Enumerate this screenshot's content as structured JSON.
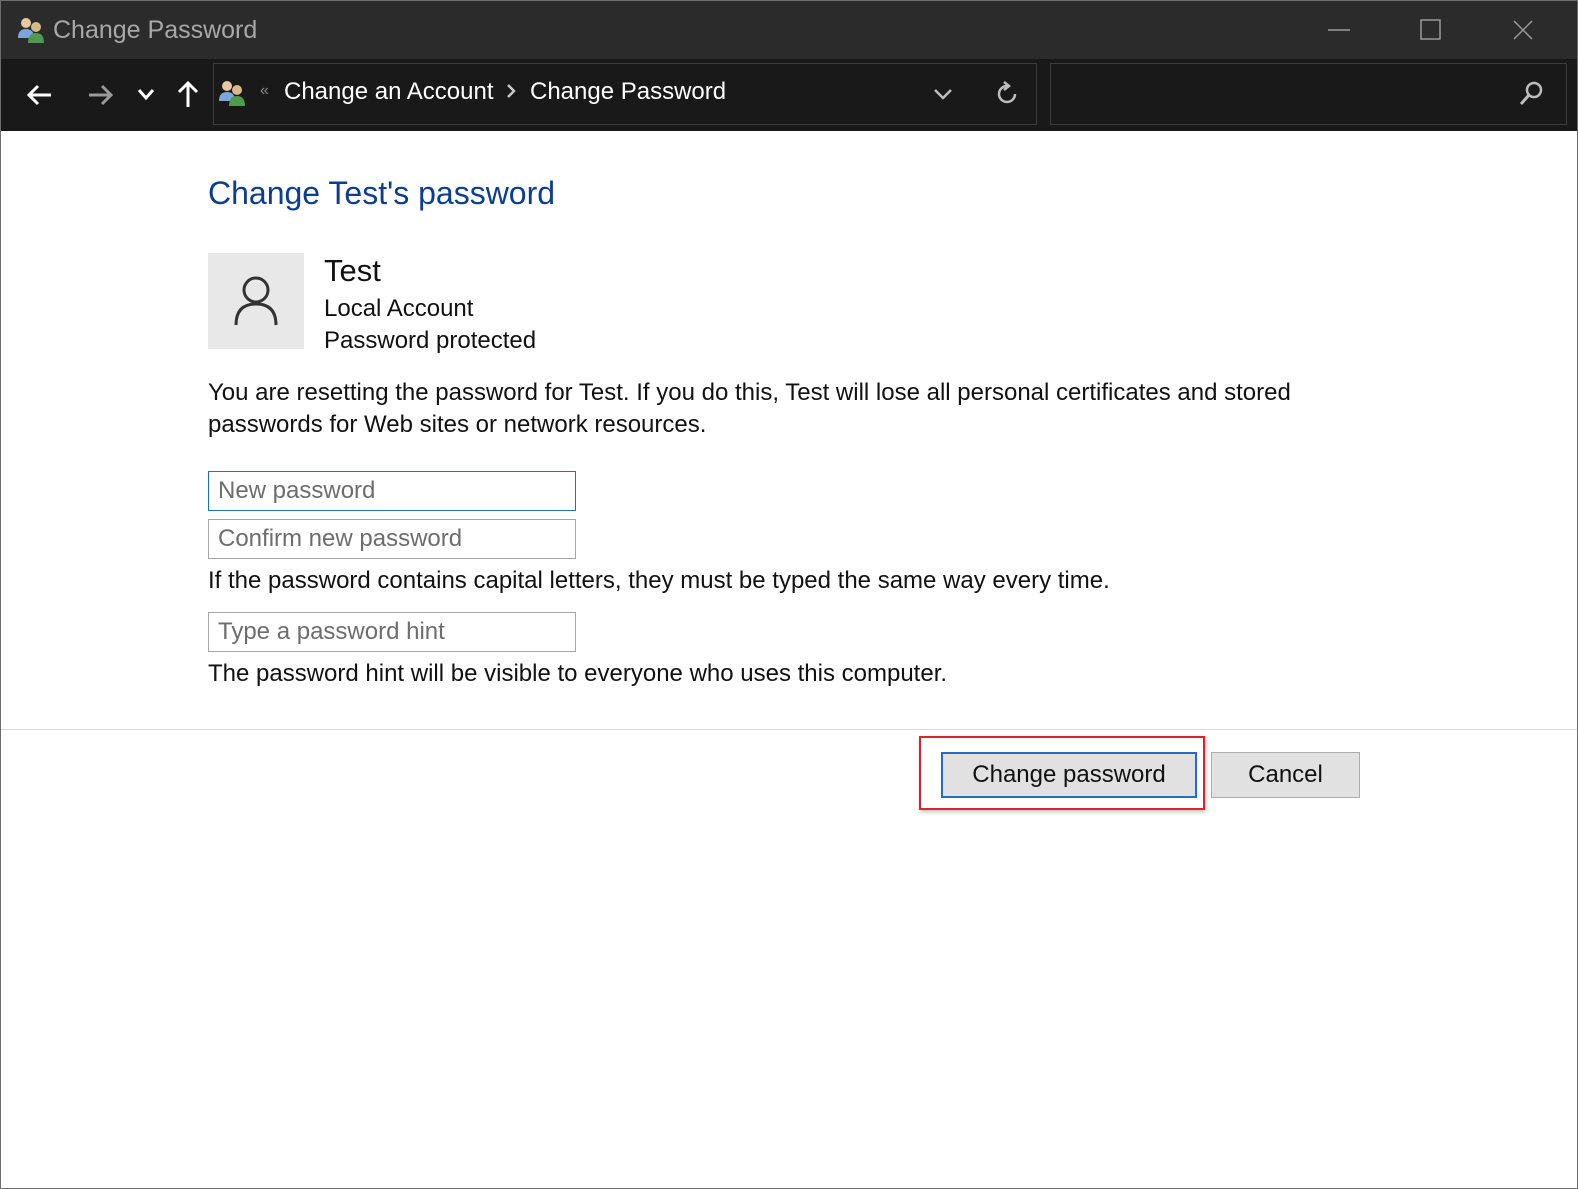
{
  "window": {
    "title": "Change Password",
    "app_icon": "users-icon"
  },
  "navbar": {
    "breadcrumb": [
      "Change an Account",
      "Change Password"
    ],
    "search_placeholder": ""
  },
  "main": {
    "heading": "Change Test's password",
    "user": {
      "name": "Test",
      "account_type": "Local Account",
      "status": "Password protected"
    },
    "warning": "You are resetting the password for Test.  If you do this, Test will lose all personal certificates and stored passwords for Web sites or network resources.",
    "fields": {
      "new_password_placeholder": "New password",
      "confirm_password_placeholder": "Confirm new password",
      "hint_placeholder": "Type a password hint"
    },
    "caps_note": "If the password contains capital letters, they must be typed the same way every time.",
    "hint_note": "The password hint will be visible to everyone who uses this computer.",
    "buttons": {
      "change": "Change password",
      "cancel": "Cancel"
    }
  },
  "colors": {
    "heading": "#0b3d91",
    "focus_border": "#1e6fc8",
    "highlight": "#d9242b"
  }
}
